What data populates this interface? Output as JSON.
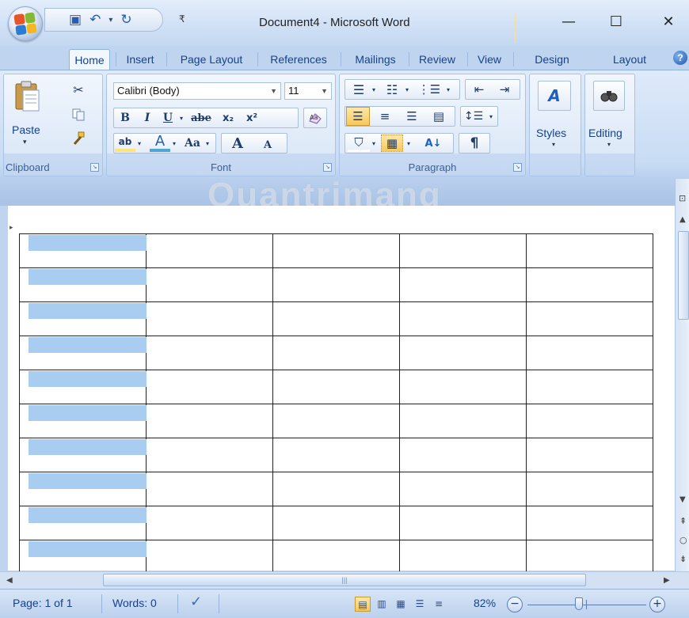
{
  "window": {
    "title": "Document4 - Microsoft Word",
    "minimize_glyph": "—",
    "maximize_glyph": "☐",
    "close_glyph": "✕",
    "qat_customize_glyph": "₹"
  },
  "tabs": [
    {
      "label": "Home",
      "active": true
    },
    {
      "label": "Insert"
    },
    {
      "label": "Page Layout"
    },
    {
      "label": "References"
    },
    {
      "label": "Mailings"
    },
    {
      "label": "Review"
    },
    {
      "label": "View"
    },
    {
      "label": "Design"
    },
    {
      "label": "Layout"
    }
  ],
  "help_glyph": "?",
  "ribbon": {
    "clipboard": {
      "label": "Clipboard",
      "paste_label": "Paste",
      "paste_arrow": "▾"
    },
    "font": {
      "label": "Font",
      "font_name": "Calibri (Body)",
      "font_size": "11",
      "bold": "B",
      "italic": "I",
      "underline": "U",
      "strike": "abe",
      "subscript": "x₂",
      "superscript": "x²",
      "change_case": "Aa",
      "grow": "A",
      "shrink": "A",
      "highlight": "ab",
      "font_color": "A"
    },
    "paragraph": {
      "label": "Paragraph",
      "pilcrow": "¶",
      "sort": "A↓"
    },
    "styles": {
      "label": "Styles"
    },
    "editing": {
      "label": "Editing"
    }
  },
  "watermark_text": "Quantrimang",
  "table": {
    "rows": 10,
    "cols": 5,
    "selected_column": 0
  },
  "status": {
    "page": "Page: 1 of 1",
    "words": "Words: 0",
    "zoom": "82%",
    "zoom_minus": "−",
    "zoom_plus": "+"
  },
  "colors": {
    "selection": "#a9cdf0",
    "ribbon_text": "#15428b",
    "highlight_yellow": "#fde37a"
  },
  "icons": [
    "office-button-icon",
    "save-icon",
    "undo-icon",
    "redo-icon",
    "cut-icon",
    "copy-icon",
    "format-painter-icon",
    "bullets-icon",
    "numbering-icon",
    "multilevel-icon",
    "decrease-indent-icon",
    "increase-indent-icon",
    "align-left-icon",
    "center-icon",
    "align-right-icon",
    "justify-icon",
    "line-spacing-icon",
    "shading-icon",
    "borders-icon",
    "sort-icon",
    "pilcrow-icon",
    "styles-icon",
    "find-icon",
    "spell-check-icon"
  ]
}
